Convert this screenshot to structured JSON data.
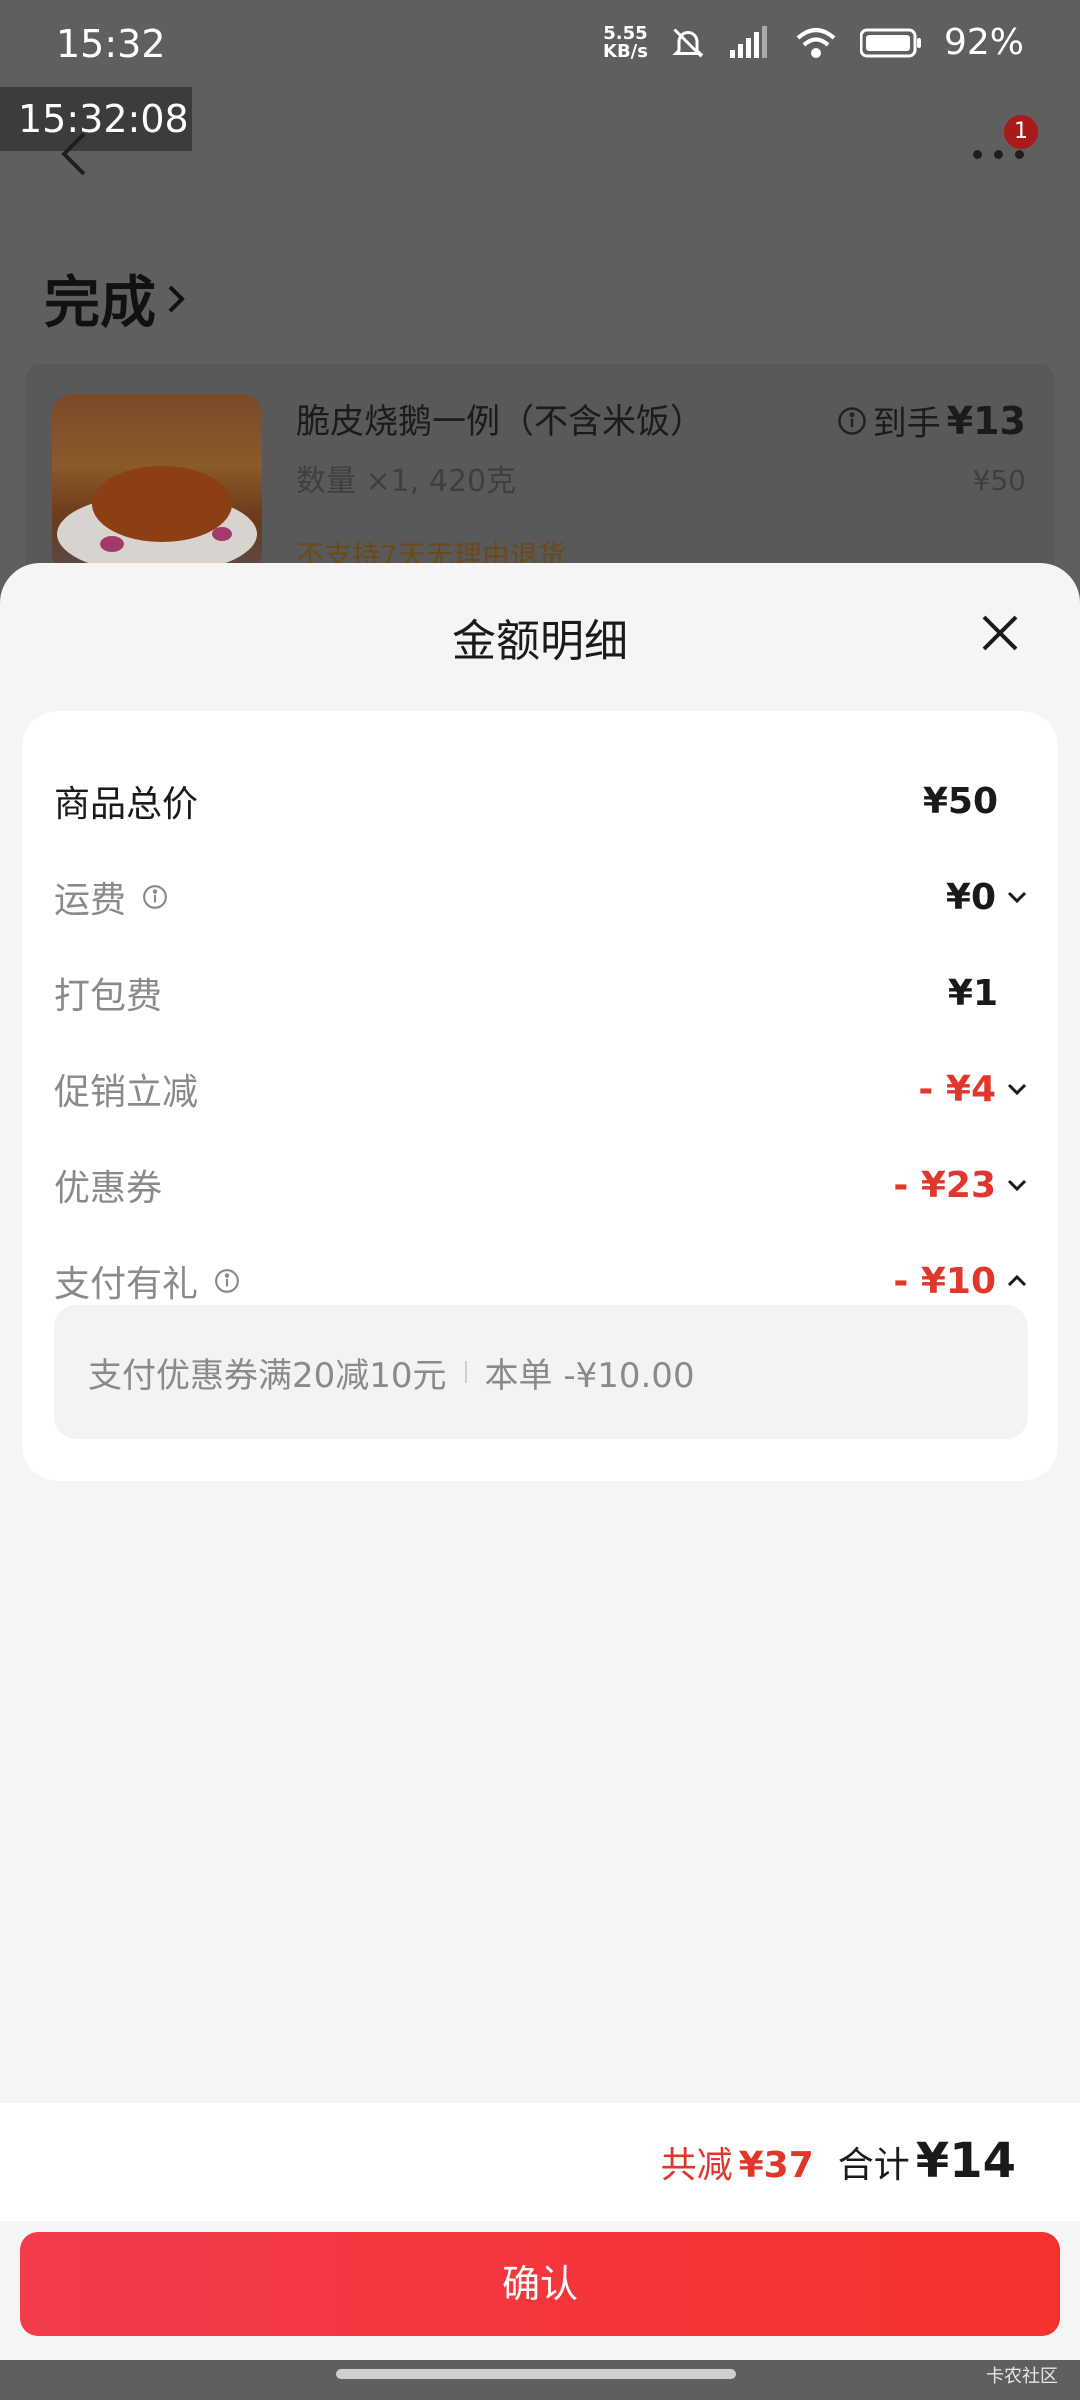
{
  "status_bar": {
    "time": "15:32",
    "net_speed_value": "5.55",
    "net_speed_unit": "KB/s",
    "battery": "92%"
  },
  "overlay_clock": "15:32:08",
  "header": {
    "notification_count": "1",
    "order_status": "完成"
  },
  "order": {
    "product_name": "脆皮烧鹅一例（不含米饭）",
    "quantity_text": "数量 ×1, 420克",
    "return_policy": "不支持7天无理由退货",
    "net_label": "到手",
    "net_price": "¥13",
    "original_price": "¥50"
  },
  "sheet": {
    "title": "金额明细",
    "rows": [
      {
        "label": "商品总价",
        "value": "¥50"
      },
      {
        "label": "运费",
        "value": "¥0"
      },
      {
        "label": "打包费",
        "value": "¥1"
      },
      {
        "label": "促销立减",
        "value": "- ¥4"
      },
      {
        "label": "优惠券",
        "value": "- ¥23"
      },
      {
        "label": "支付有礼",
        "value": "- ¥10"
      }
    ],
    "pay_gift_detail": {
      "coupon": "支付优惠券满20减10元",
      "this_order": "本单 -¥10.00"
    }
  },
  "summary": {
    "discount_label": "共减",
    "discount_amount": "¥37",
    "total_label": "合计",
    "total_amount": "¥14"
  },
  "confirm_label": "确认",
  "watermark": "卡农社区",
  "colors": {
    "accent_red": "#e0362b",
    "button_gradient_start": "#f33b4d",
    "button_gradient_end": "#f5322d"
  }
}
